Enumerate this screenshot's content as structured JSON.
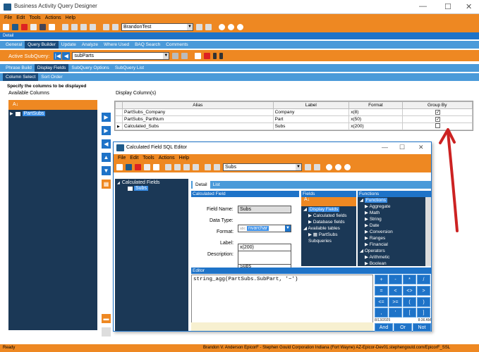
{
  "window": {
    "title": "Business Activity Query Designer"
  },
  "menu": [
    "File",
    "Edit",
    "Tools",
    "Actions",
    "Help"
  ],
  "toolbar": {
    "query_combo": "BrandonTest"
  },
  "detail_label": "Detail",
  "main_tabs": [
    "General",
    "Query Builder",
    "Update",
    "Analyze",
    "Where Used",
    "BAQ Search",
    "Comments"
  ],
  "active_subquery": {
    "label": "Active SubQuery:",
    "value": "subParts"
  },
  "sub_tabs": [
    "Phrase Build",
    "Display Fields",
    "SubQuery Options",
    "SubQuery List"
  ],
  "sub_tabs2": [
    "Column Select",
    "Sort Order"
  ],
  "instruction": "Specify the columns to be displayed",
  "available_columns": {
    "label": "Available Columns",
    "items": [
      "PartSubs"
    ]
  },
  "display_columns": {
    "label": "Display Column(s)",
    "headers": [
      "Alias",
      "Label",
      "Format",
      "Group By"
    ],
    "rows": [
      {
        "alias": "PartSubs_Company",
        "label": "Company",
        "format": "x(8)",
        "group": true
      },
      {
        "alias": "PartSubs_PartNum",
        "label": "Part",
        "format": "x(50)",
        "group": true
      },
      {
        "alias": "Calculated_Subs",
        "label": "Subs",
        "format": "x(200)",
        "group": false
      }
    ]
  },
  "dialog": {
    "title": "Calculated Field SQL Editor",
    "menu": [
      "File",
      "Edit",
      "Tools",
      "Actions",
      "Help"
    ],
    "combo": "Subs",
    "tree_root": "Calculated Fields",
    "tree_child": "Subs",
    "tabs": [
      "Detail",
      "List"
    ],
    "section_calc": "Calculated Field",
    "field_name_label": "Field Name:",
    "field_name": "Subs",
    "data_type_label": "Data Type:",
    "data_type": "nvarchar",
    "data_type_prefix": "abc",
    "format_label": "Format:",
    "format": "x(200)",
    "label_label": "Label:",
    "label": "Subs",
    "description_label": "Description:",
    "fields_header": "Fields",
    "fields_items": [
      "Display Fields",
      "Calculated fields",
      "Database fields",
      "Available tables",
      "PartSubs",
      "Subqueries"
    ],
    "functions_header": "Functions",
    "functions_items": [
      "Functions",
      "Aggregate",
      "Math",
      "String",
      "Date",
      "Conversion",
      "Ranges",
      "Financial",
      "Operators",
      "Arithmetic",
      "Boolean"
    ],
    "editor_label": "Editor",
    "editor_text": "string_agg(PartSubs.SubPart, '~')",
    "keypad": [
      "+",
      "-",
      "*",
      "/",
      "=",
      "<",
      "<>",
      ">",
      "<=",
      ">=",
      "(",
      ")",
      ",",
      "'",
      "[",
      "]"
    ],
    "keypad_bottom": [
      "And",
      "Or",
      "Not"
    ],
    "date": "8/13/2025",
    "time": "8:36 AM"
  },
  "status": {
    "left": "Ready",
    "right": "Brandon V. Anderson  EpicorF - Stephen Gould Corporation  Indiana (Fort Wayne)  AZ-Epicor-Dev01.stephengould.com/EpicorF_SSL"
  },
  "colors": {
    "orange": "#ee8822",
    "blue": "#1e73c8",
    "navy": "#1b3856",
    "arrow": "#cc2222"
  }
}
